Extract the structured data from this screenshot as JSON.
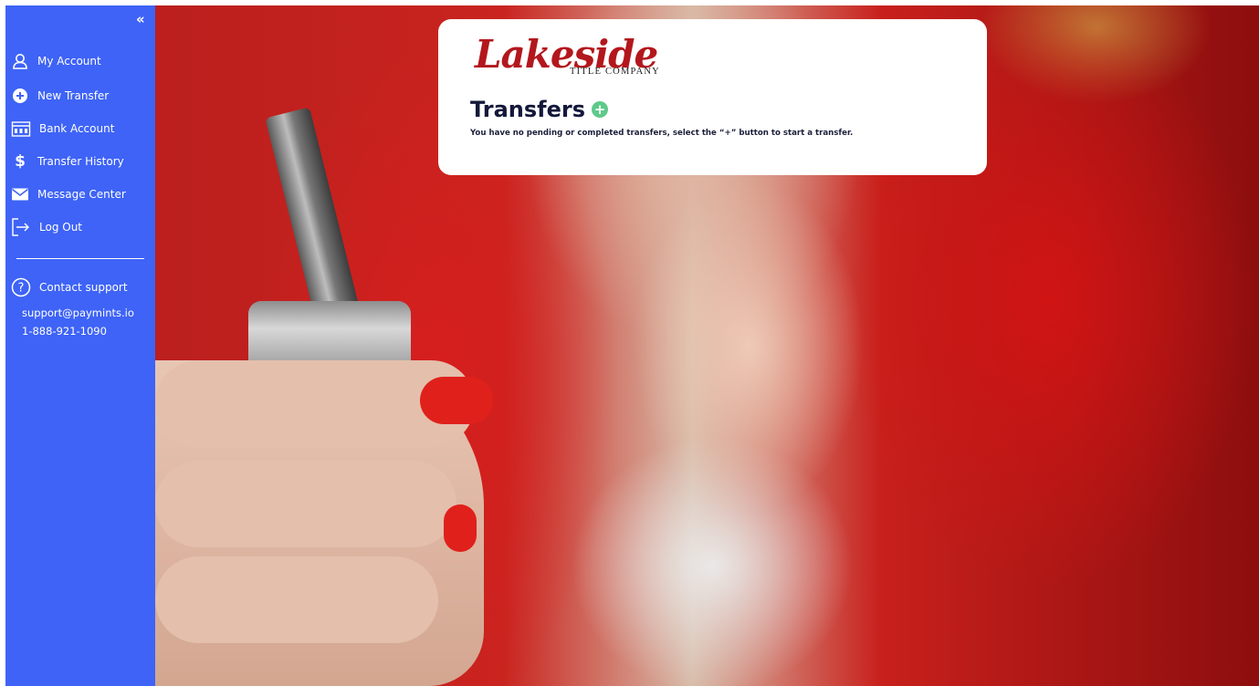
{
  "sidebar": {
    "collapse_label": "«",
    "items": [
      {
        "label": "My Account",
        "icon": "user-icon"
      },
      {
        "label": "New Transfer",
        "icon": "plus-circle-icon"
      },
      {
        "label": "Bank Account",
        "icon": "bank-icon"
      },
      {
        "label": "Transfer History",
        "icon": "dollar-icon"
      },
      {
        "label": "Message Center",
        "icon": "envelope-icon"
      },
      {
        "label": "Log Out",
        "icon": "logout-icon"
      }
    ],
    "support": {
      "label": "Contact support",
      "icon": "question-circle-icon",
      "email": "support@paymints.io",
      "phone": "1-888-921-1090"
    }
  },
  "logo": {
    "main": "Lakeside",
    "sub": "TITLE COMPANY",
    "color": "#b3171d"
  },
  "main": {
    "title": "Transfers",
    "add_button": "+",
    "message": "You have no pending or completed transfers, select the “+” button to start a transfer."
  },
  "colors": {
    "sidebar": "#3e63f6",
    "add_button": "#5ec98a",
    "title": "#14183a"
  }
}
